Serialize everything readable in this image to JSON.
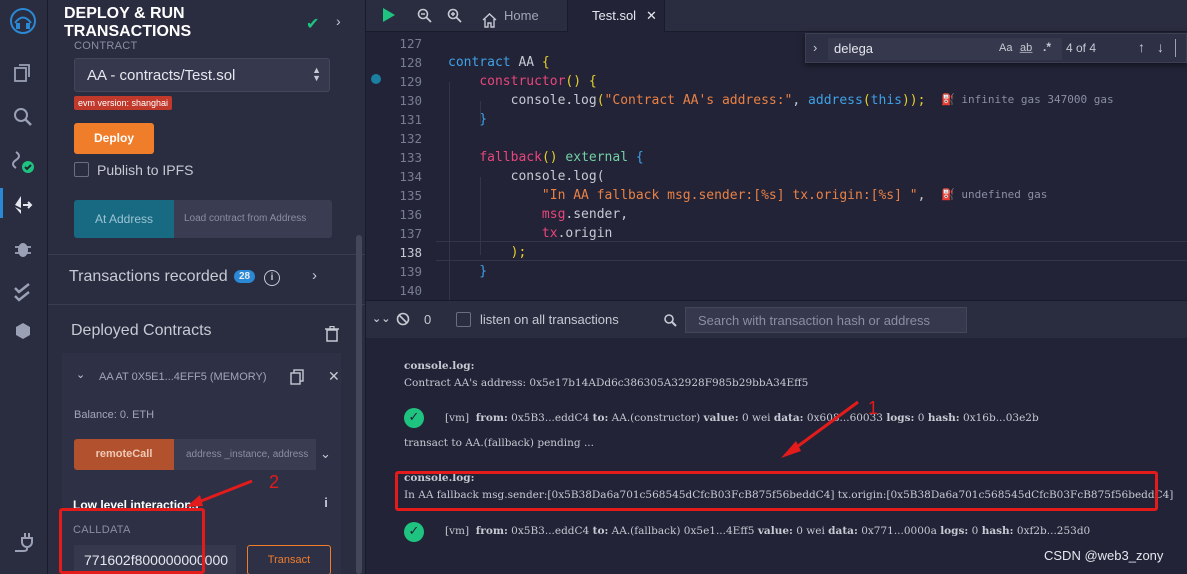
{
  "panel": {
    "title": "DEPLOY & RUN TRANSACTIONS",
    "contract_label": "CONTRACT",
    "contract_selected": "AA - contracts/Test.sol",
    "evm_badge": "evm version: shanghai",
    "deploy_label": "Deploy",
    "publish_ipfs_label": "Publish to IPFS",
    "at_address_label": "At Address",
    "at_address_placeholder": "Load contract from Address",
    "transactions_recorded_label": "Transactions recorded",
    "transactions_recorded_count": "28",
    "deployed_contracts_label": "Deployed Contracts",
    "deployed_instance_label": "AA AT 0X5E1...4EFF5 (MEMORY)",
    "balance_label": "Balance: 0. ETH",
    "remote_call_label": "remoteCall",
    "remote_call_placeholder": "address _instance, address",
    "low_level_label": "Low level interactions",
    "calldata_label": "CALLDATA",
    "calldata_value": "771602f800000000000",
    "transact_label": "Transact"
  },
  "tabs": {
    "home_label": "Home",
    "file_label": "Test.sol"
  },
  "find": {
    "query": "delega",
    "match_case": "Aa",
    "whole_word": "a̲b̲",
    "regex": ".*",
    "count": "4 of 4"
  },
  "editor": {
    "lines": [
      {
        "num": "127",
        "parts": []
      },
      {
        "num": "128",
        "parts": [
          {
            "t": "contract ",
            "c": "k"
          },
          {
            "t": "AA",
            "c": ""
          },
          {
            "t": " {",
            "c": "y"
          }
        ]
      },
      {
        "num": "129",
        "parts": [
          {
            "t": "    ",
            "c": ""
          },
          {
            "t": "constructor",
            "c": "f"
          },
          {
            "t": "() ",
            "c": "y"
          },
          {
            "t": "{",
            "c": "y"
          }
        ]
      },
      {
        "num": "130",
        "parts": [
          {
            "t": "        console.",
            "c": ""
          },
          {
            "t": "log",
            "c": ""
          },
          {
            "t": "(",
            "c": "y"
          },
          {
            "t": "\"Contract AA's address:\"",
            "c": "s"
          },
          {
            "t": ", ",
            "c": ""
          },
          {
            "t": "address",
            "c": "k"
          },
          {
            "t": "(",
            "c": "y"
          },
          {
            "t": "this",
            "c": "k"
          },
          {
            "t": "));",
            "c": "y"
          }
        ]
      },
      {
        "num": "131",
        "parts": [
          {
            "t": "    }",
            "c": "k"
          }
        ]
      },
      {
        "num": "132",
        "parts": []
      },
      {
        "num": "133",
        "parts": [
          {
            "t": "    ",
            "c": ""
          },
          {
            "t": "fallback",
            "c": "f"
          },
          {
            "t": "() ",
            "c": "y"
          },
          {
            "t": "external",
            "c": "g"
          },
          {
            "t": " {",
            "c": "k"
          }
        ]
      },
      {
        "num": "134",
        "parts": [
          {
            "t": "        console.log(",
            "c": ""
          }
        ]
      },
      {
        "num": "135",
        "parts": [
          {
            "t": "            ",
            "c": ""
          },
          {
            "t": "\"In AA fallback msg.sender:[%s] tx.origin:[%s] \"",
            "c": "s"
          },
          {
            "t": ",",
            "c": ""
          }
        ]
      },
      {
        "num": "136",
        "parts": [
          {
            "t": "            ",
            "c": ""
          },
          {
            "t": "msg",
            "c": "f"
          },
          {
            "t": ".sender,",
            "c": ""
          }
        ]
      },
      {
        "num": "137",
        "parts": [
          {
            "t": "            ",
            "c": ""
          },
          {
            "t": "tx",
            "c": "f"
          },
          {
            "t": ".origin",
            "c": ""
          }
        ]
      },
      {
        "num": "138",
        "parts": [
          {
            "t": "        ",
            "c": ""
          },
          {
            "t": ");",
            "c": "y"
          }
        ]
      },
      {
        "num": "139",
        "parts": [
          {
            "t": "    }",
            "c": "k"
          }
        ]
      },
      {
        "num": "140",
        "parts": []
      }
    ],
    "gas_hint_1": "infinite gas 347000 gas",
    "gas_hint_2": "undefined gas"
  },
  "terminal_bar": {
    "count": "0",
    "listen_label": "listen on all transactions",
    "search_placeholder": "Search with transaction hash or address"
  },
  "terminal": {
    "log1_title": "console.log:",
    "log1_text": "Contract AA's address: 0x5e17b14ADd6c386305A32928F985b29bbA34Eff5",
    "tx1": {
      "tag": "[vm]",
      "from_label": "from:",
      "from": "0x5B3...eddC4",
      "to_label": "to:",
      "to": "AA.(constructor)",
      "value_label": "value:",
      "value": "0 wei",
      "data_label": "data:",
      "data": "0x608...60033",
      "logs_label": "logs:",
      "logs": "0",
      "hash_label": "hash:",
      "hash": "0x16b...03e2b"
    },
    "pending_text": "transact to AA.(fallback) pending ...",
    "log2_title": "console.log:",
    "log2_text": "In AA fallback msg.sender:[0x5B38Da6a701c568545dCfcB03FcB875f56beddC4] tx.origin:[0x5B38Da6a701c568545dCfcB03FcB875f56beddC4]",
    "tx2": {
      "tag": "[vm]",
      "from_label": "from:",
      "from": "0x5B3...eddC4",
      "to_label": "to:",
      "to": "AA.(fallback) 0x5e1...4Eff5",
      "value_label": "value:",
      "value": "0 wei",
      "data_label": "data:",
      "data": "0x771...0000a",
      "logs_label": "logs:",
      "logs": "0",
      "hash_label": "hash:",
      "hash": "0xf2b...253d0"
    }
  },
  "annotations": {
    "one": "1",
    "two": "2"
  },
  "watermark": "CSDN @web3_zony",
  "colors": {
    "accent": "#2a88d4",
    "deploy": "#f07d2a",
    "success": "#1fc380",
    "annotation": "#e31b1b"
  }
}
